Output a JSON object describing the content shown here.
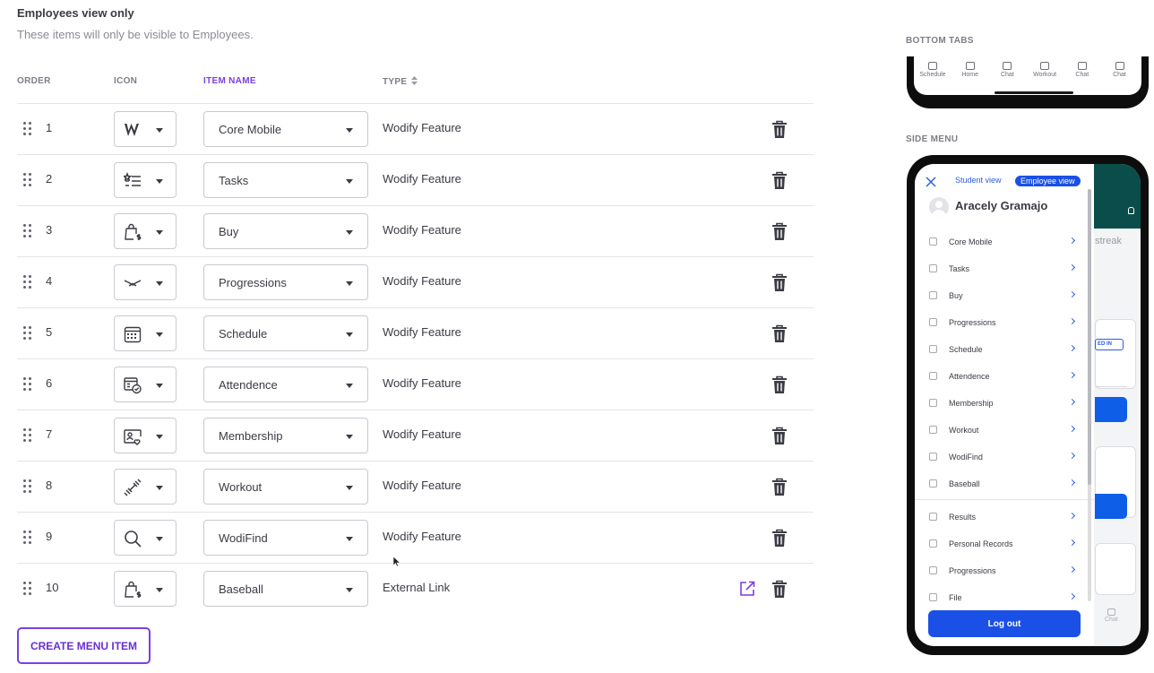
{
  "section": {
    "title": "Employees view only",
    "description": "These items will only be visible to Employees."
  },
  "table": {
    "headers": {
      "order": "ORDER",
      "icon": "ICON",
      "item_name": "ITEM NAME",
      "type": "TYPE"
    },
    "rows": [
      {
        "order": "1",
        "icon": "w-logo-icon",
        "name": "Core Mobile",
        "type": "Wodify Feature"
      },
      {
        "order": "2",
        "icon": "task-list-icon",
        "name": "Tasks",
        "type": "Wodify Feature"
      },
      {
        "order": "3",
        "icon": "shopping-bag-dollar-icon",
        "name": "Buy",
        "type": "Wodify Feature"
      },
      {
        "order": "4",
        "icon": "progression-icon",
        "name": "Progressions",
        "type": "Wodify Feature"
      },
      {
        "order": "5",
        "icon": "calendar-icon",
        "name": "Schedule",
        "type": "Wodify Feature"
      },
      {
        "order": "6",
        "icon": "attendance-check-icon",
        "name": "Attendence",
        "type": "Wodify Feature"
      },
      {
        "order": "7",
        "icon": "membership-card-icon",
        "name": "Membership",
        "type": "Wodify Feature"
      },
      {
        "order": "8",
        "icon": "dumbbell-icon",
        "name": "Workout",
        "type": "Wodify Feature"
      },
      {
        "order": "9",
        "icon": "search-icon",
        "name": "WodiFind",
        "type": "Wodify Feature"
      },
      {
        "order": "10",
        "icon": "shopping-bag-dollar-icon",
        "name": "Baseball",
        "type": "External Link"
      }
    ]
  },
  "create_button": "CREATE MENU ITEM",
  "preview": {
    "bottom_tabs_label": "BOTTOM TABS",
    "bottom_tabs": [
      "Schedule",
      "Home",
      "Chat",
      "Workout",
      "Chat",
      "Chat"
    ],
    "side_menu_label": "SIDE MENU",
    "side_menu": {
      "student_view": "Student view",
      "employee_view": "Employee view",
      "user_name": "Aracely Gramajo",
      "items": [
        "Core Mobile",
        "Tasks",
        "Buy",
        "Progressions",
        "Schedule",
        "Attendence",
        "Membership",
        "Workout",
        "WodiFind",
        "Baseball"
      ],
      "extra_items": [
        "Results",
        "Personal Records",
        "Progressions",
        "File"
      ],
      "logout": "Log out",
      "behind": {
        "streak": "streak",
        "badge": "ED IN",
        "chat": "Chat"
      }
    }
  },
  "colors": {
    "accent": "#7b3fe4",
    "primary_blue": "#1a50e6",
    "header_teal": "#0b4d4a"
  }
}
